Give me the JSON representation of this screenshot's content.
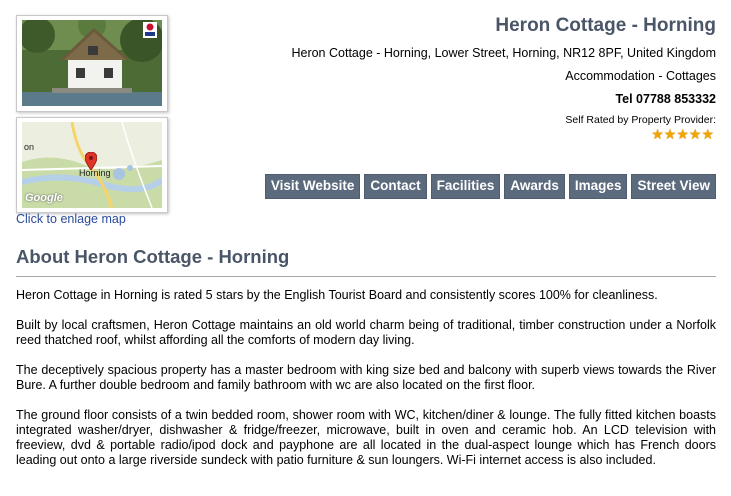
{
  "property": {
    "title": "Heron Cottage - Horning",
    "address": "Heron Cottage - Horning, Lower Street, Horning, NR12 8PF, United Kingdom",
    "category": "Accommodation - Cottages",
    "tel": "Tel 07788 853332",
    "rating_label": "Self Rated by Property Provider:",
    "rating_stars": "★★★★★",
    "rating_value": 5
  },
  "map": {
    "label_left": "on",
    "label_town": "Horning",
    "brand": "Google",
    "link_text": "Click to enlage map"
  },
  "nav": {
    "items": [
      "Visit Website",
      "Contact",
      "Facilities",
      "Awards",
      "Images",
      "Street View"
    ]
  },
  "about": {
    "title": "About Heron Cottage - Horning",
    "paragraphs": [
      "Heron Cottage in Horning is rated 5 stars by the English Tourist Board and consistently scores 100% for cleanliness.",
      "Built by local craftsmen, Heron Cottage maintains an old world charm being of traditional, timber construction under a Norfolk reed thatched roof, whilst affording all the comforts of modern day living.",
      "The deceptively spacious property has a master bedroom with king size bed and balcony with superb views towards the River Bure. A further double bedroom and family bathroom with wc are also located on the first floor.",
      "The ground floor consists of a twin bedded room, shower room with WC, kitchen/diner & lounge. The fully fitted kitchen boasts integrated washer/dryer, dishwasher & fridge/freezer, microwave, built in oven and ceramic hob. An LCD television with freeview, dvd & portable radio/ipod dock and payphone are all located in the dual-aspect lounge which has French doors leading out onto a large riverside sundeck with patio furniture & sun loungers. Wi-Fi internet access is also included."
    ]
  },
  "colors": {
    "heading": "#4a5668",
    "nav_bg": "#5b6a7d",
    "link": "#2a4a9a",
    "star": "#f2a400"
  }
}
